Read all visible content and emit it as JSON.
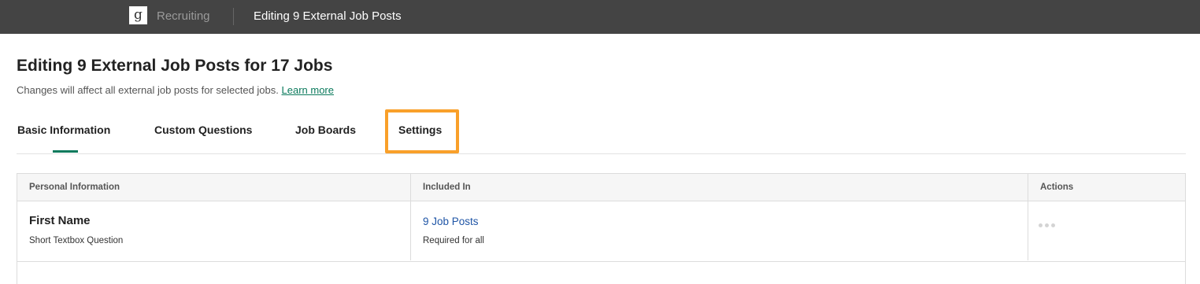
{
  "topbar": {
    "logo_letter": "g",
    "app_name": "Recruiting",
    "title": "Editing 9 External Job Posts"
  },
  "page": {
    "title": "Editing 9 External Job Posts for 17 Jobs",
    "subtitle": "Changes will affect all external job posts for selected jobs.",
    "learn_more": "Learn more"
  },
  "tabs": [
    {
      "label": "Basic Information",
      "active": true
    },
    {
      "label": "Custom Questions",
      "active": false
    },
    {
      "label": "Job Boards",
      "active": false
    },
    {
      "label": "Settings",
      "active": false,
      "highlighted": true
    }
  ],
  "colors": {
    "accent": "#0b7a5c",
    "highlight": "#f9a02a",
    "link": "#1f55a6",
    "topbar": "#444444"
  },
  "table": {
    "headers": [
      "Personal Information",
      "Included In",
      "Actions"
    ],
    "rows": [
      {
        "name": "First Name",
        "type": "Short Textbox Question",
        "included_in": "9 Job Posts",
        "requirement": "Required for all",
        "action_icon": "more-dots-icon"
      }
    ]
  }
}
